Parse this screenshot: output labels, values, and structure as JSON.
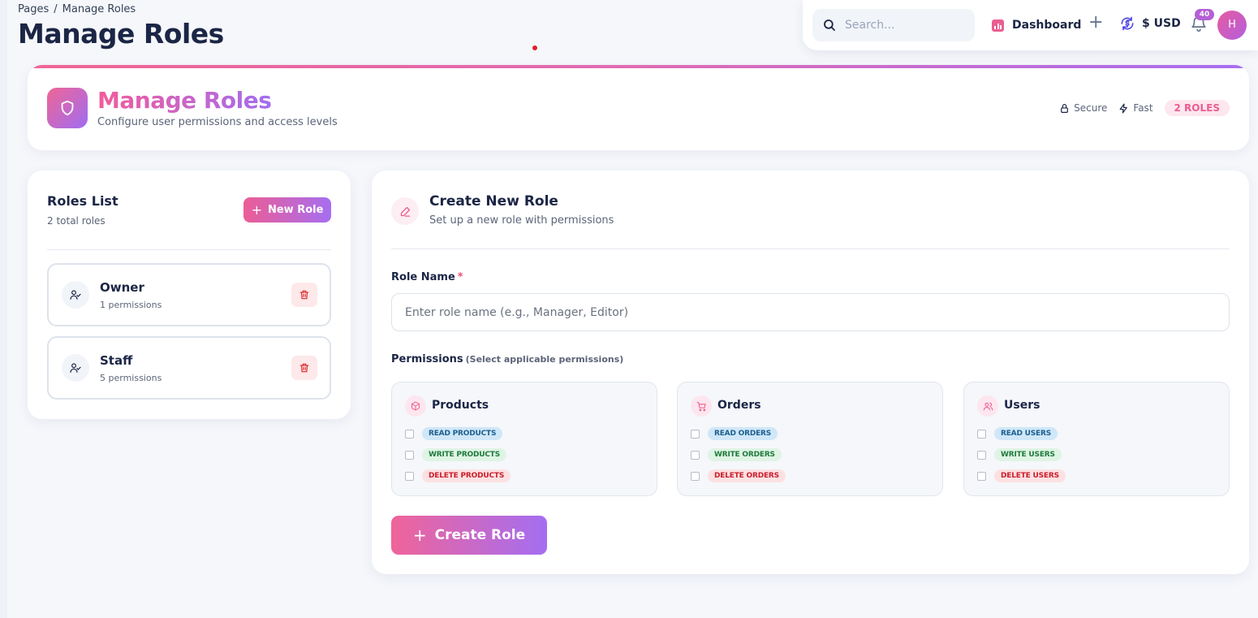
{
  "breadcrumb": {
    "root": "Pages",
    "separator": "/",
    "current": "Manage Roles"
  },
  "page_title": "Manage Roles",
  "topbar": {
    "search_placeholder": "Search...",
    "dashboard_label": "Dashboard",
    "currency_label": "$ USD",
    "notification_count": "40",
    "avatar_initial": "H"
  },
  "hero": {
    "title": "Manage Roles",
    "subtitle": "Configure user permissions and access levels",
    "secure_label": "Secure",
    "fast_label": "Fast",
    "roles_badge": "2 ROLES"
  },
  "roles_list": {
    "title": "Roles List",
    "subtitle": "2 total roles",
    "new_role_label": "New Role",
    "items": [
      {
        "name": "Owner",
        "permissions": "1 permissions"
      },
      {
        "name": "Staff",
        "permissions": "5 permissions"
      }
    ]
  },
  "create_role": {
    "title": "Create New Role",
    "subtitle": "Set up a new role with permissions",
    "role_name_label": "Role Name",
    "required_mark": "*",
    "role_name_placeholder": "Enter role name (e.g., Manager, Editor)",
    "permissions_label": "Permissions",
    "permissions_hint": "(Select applicable permissions)",
    "groups": [
      {
        "name": "Products",
        "icon": "box-icon",
        "perms": [
          "READ PRODUCTS",
          "WRITE PRODUCTS",
          "DELETE PRODUCTS"
        ]
      },
      {
        "name": "Orders",
        "icon": "cart-icon",
        "perms": [
          "READ ORDERS",
          "WRITE ORDERS",
          "DELETE ORDERS"
        ]
      },
      {
        "name": "Users",
        "icon": "users-icon",
        "perms": [
          "READ USERS",
          "WRITE USERS",
          "DELETE USERS"
        ]
      }
    ],
    "submit_label": "Create Role"
  },
  "colors": {
    "accent_pink": "#ec5d91",
    "accent_purple": "#a66ef0",
    "title_text": "#1b2545",
    "read_tag": "#cfe7f8",
    "write_tag": "#dff4e4",
    "delete_tag": "#fde1e2"
  }
}
